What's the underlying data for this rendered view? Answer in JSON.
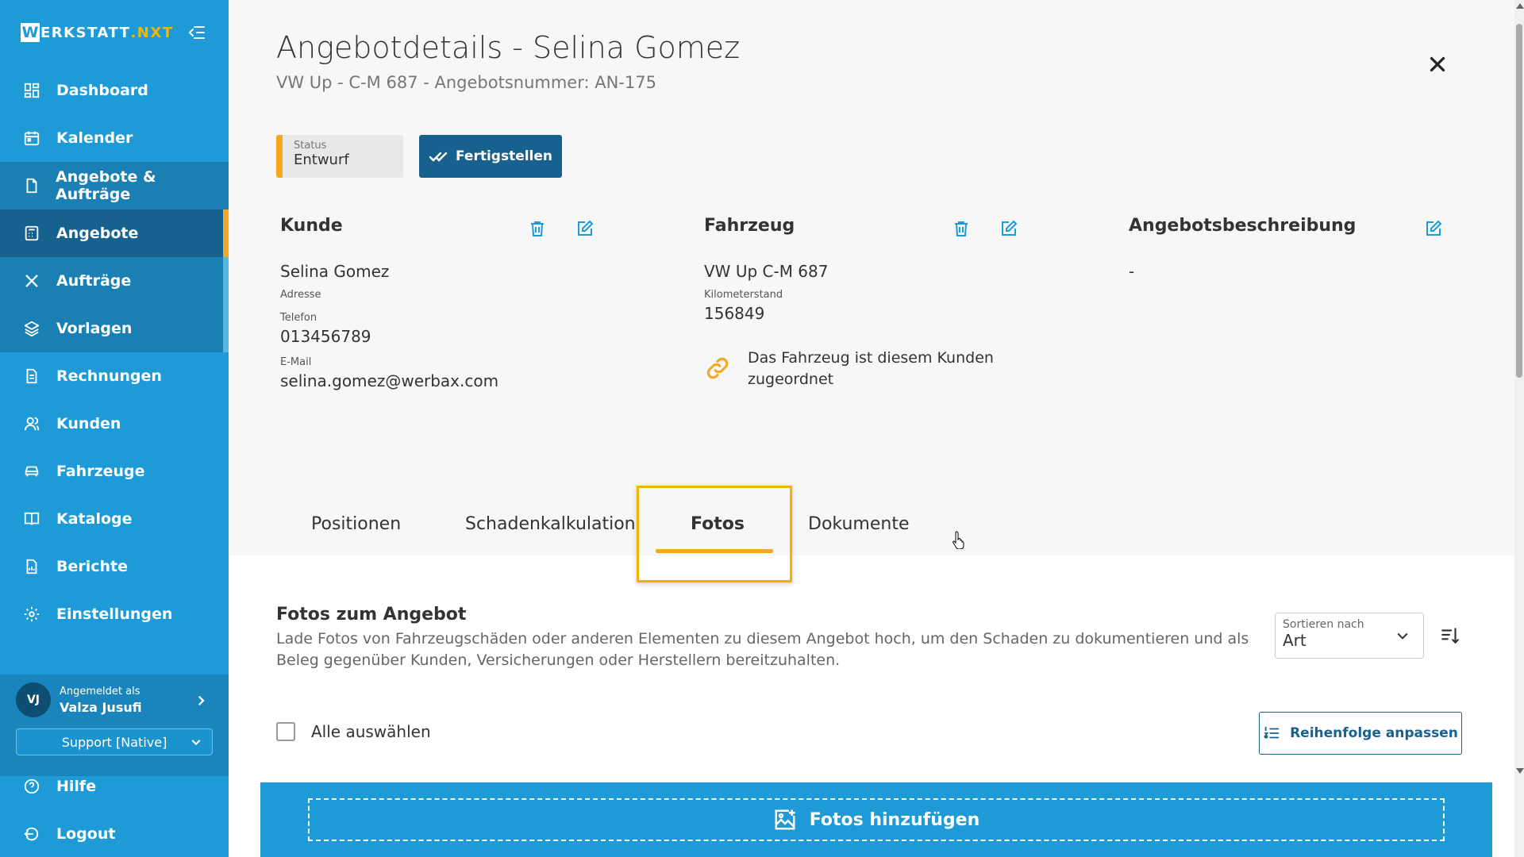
{
  "app": {
    "logo_w": "W",
    "logo_main": "ERKSTATT",
    "logo_suffix": ".NXT"
  },
  "sidebar": {
    "items": [
      {
        "label": "Dashboard",
        "icon": "dashboard-icon"
      },
      {
        "label": "Kalender",
        "icon": "calendar-icon"
      },
      {
        "label": "Angebote & Aufträge",
        "icon": "document-icon"
      },
      {
        "label": "Angebote",
        "icon": "calculator-icon"
      },
      {
        "label": "Aufträge",
        "icon": "tools-icon"
      },
      {
        "label": "Vorlagen",
        "icon": "layers-icon"
      },
      {
        "label": "Rechnungen",
        "icon": "invoice-icon"
      },
      {
        "label": "Kunden",
        "icon": "customers-icon"
      },
      {
        "label": "Fahrzeuge",
        "icon": "car-icon"
      },
      {
        "label": "Kataloge",
        "icon": "book-icon"
      },
      {
        "label": "Berichte",
        "icon": "report-icon"
      },
      {
        "label": "Einstellungen",
        "icon": "gear-icon"
      }
    ],
    "user": {
      "initials": "VJ",
      "logged_in_label": "Angemeldet als",
      "name": "Valza Jusufi",
      "role": "Support [Native]"
    },
    "help": "Hilfe",
    "logout": "Logout"
  },
  "header": {
    "title": "Angebotdetails - Selina Gomez",
    "subtitle": "VW Up - C-M 687 - Angebotsnummer: AN-175"
  },
  "status": {
    "label": "Status",
    "value": "Entwurf"
  },
  "finish_button": "Fertigstellen",
  "customer": {
    "heading": "Kunde",
    "name": "Selina Gomez",
    "address_label": "Adresse",
    "phone_label": "Telefon",
    "phone": "013456789",
    "email_label": "E-Mail",
    "email": "selina.gomez@werbax.com"
  },
  "vehicle": {
    "heading": "Fahrzeug",
    "name": "VW Up C-M 687",
    "mileage_label": "Kilometerstand",
    "mileage": "156849",
    "link_note_line1": "Das Fahrzeug ist diesem Kunden",
    "link_note_line2": "zugeordnet"
  },
  "description": {
    "heading": "Angebotsbeschreibung",
    "value": "-"
  },
  "tabs": [
    {
      "label": "Positionen"
    },
    {
      "label": "Schadenkalkulation"
    },
    {
      "label": "Fotos",
      "active": true
    },
    {
      "label": "Dokumente"
    }
  ],
  "photos": {
    "heading": "Fotos zum Angebot",
    "description": "Lade Fotos von Fahrzeugschäden oder anderen Elementen zu diesem Angebot hoch, um den Schaden zu dokumentieren und als Beleg gegenüber Kunden, Versicherungen oder Herstellern bereitzuhalten.",
    "sort_label": "Sortieren nach",
    "sort_value": "Art",
    "select_all": "Alle auswählen",
    "reorder_button": "Reihenfolge anpassen",
    "upload_button": "Fotos hinzufügen"
  },
  "colors": {
    "sidebar": "#1e9ad6",
    "active": "#17618e",
    "accent": "#f5a623",
    "icon_blue": "#1e9ad6"
  }
}
